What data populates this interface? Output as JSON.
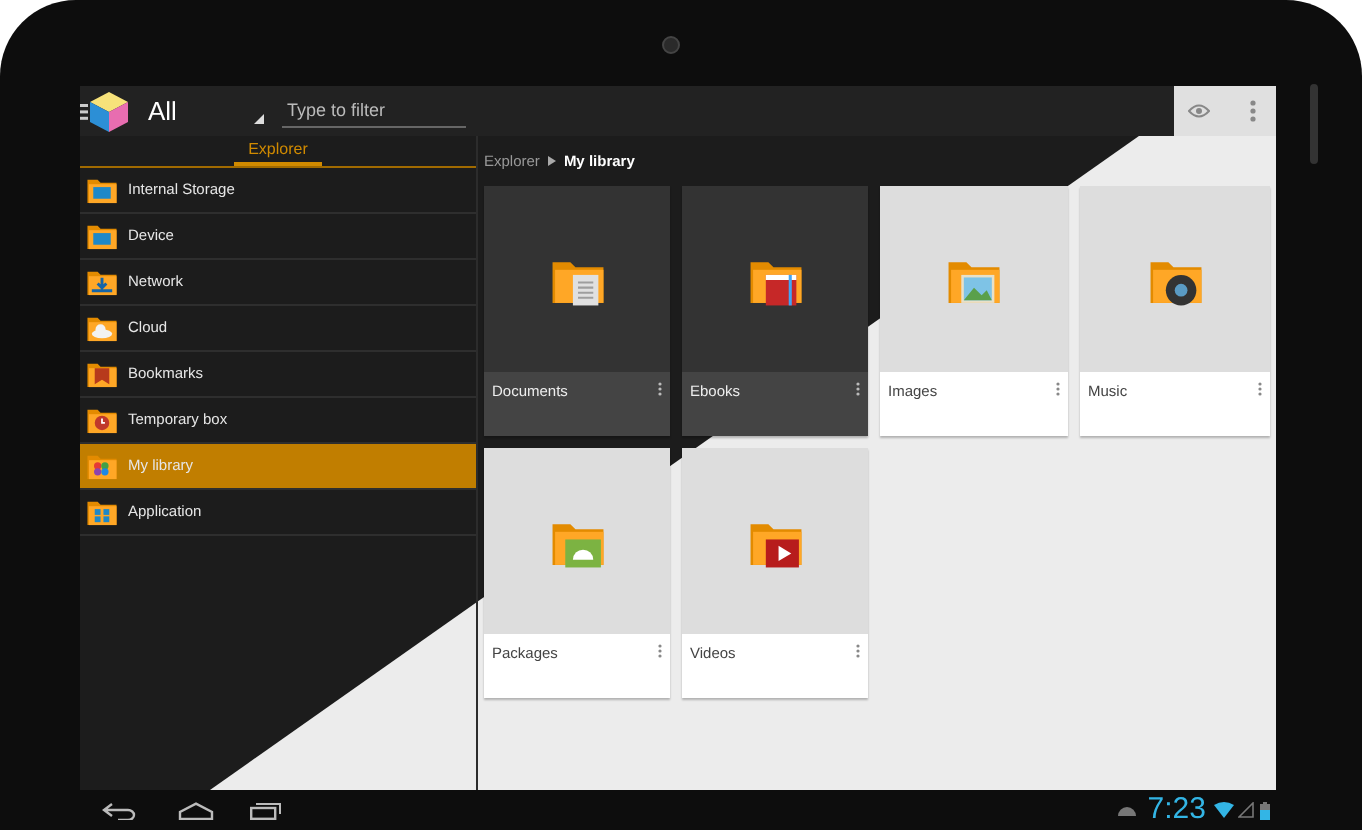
{
  "app_bar": {
    "title": "All",
    "filter": {
      "placeholder": "Type to filter"
    }
  },
  "sidebar": {
    "tabs": [
      {
        "label": "Explorer",
        "selected": true
      }
    ],
    "items": [
      {
        "label": "Internal Storage",
        "kind": "storage",
        "selected": false
      },
      {
        "label": "Device",
        "kind": "device",
        "selected": false
      },
      {
        "label": "Network",
        "kind": "network",
        "selected": false
      },
      {
        "label": "Cloud",
        "kind": "cloud",
        "selected": false
      },
      {
        "label": "Bookmarks",
        "kind": "bookmark",
        "selected": false
      },
      {
        "label": "Temporary box",
        "kind": "clock",
        "selected": false
      },
      {
        "label": "My library",
        "kind": "library",
        "selected": true
      },
      {
        "label": "Application",
        "kind": "apps",
        "selected": false
      }
    ]
  },
  "breadcrumb": [
    "Explorer",
    "My library"
  ],
  "cards": [
    {
      "label": "Documents",
      "kind": "document",
      "dark": true
    },
    {
      "label": "Ebooks",
      "kind": "ebook",
      "dark": true
    },
    {
      "label": "Images",
      "kind": "image",
      "dark": false
    },
    {
      "label": "Music",
      "kind": "music",
      "dark": false
    },
    {
      "label": "Packages",
      "kind": "android",
      "dark": false
    },
    {
      "label": "Videos",
      "kind": "video",
      "dark": false
    }
  ],
  "status_bar": {
    "time": "7:23"
  }
}
